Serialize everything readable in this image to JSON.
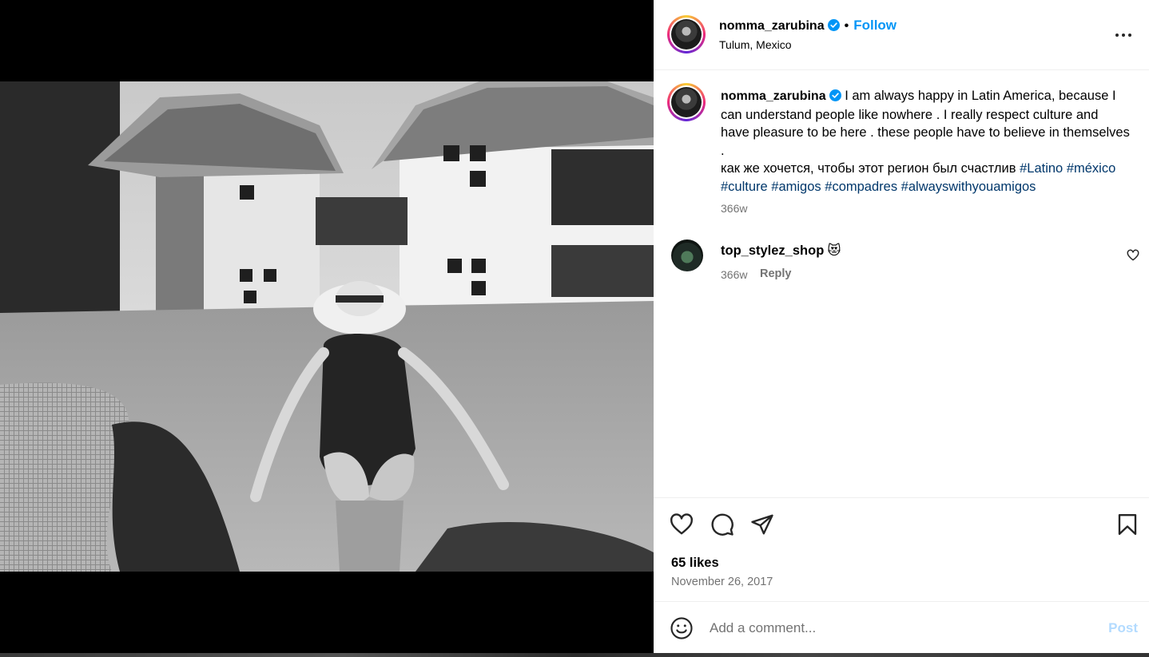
{
  "post": {
    "username": "nomma_zarubina",
    "follow_label": "Follow",
    "location": "Tulum, Mexico",
    "caption": {
      "line1": "I am always happy in Latin America, because I can understand people like nowhere . I really respect culture and have pleasure to be here . these people have to believe in themselves .",
      "line2": "как же хочется, чтобы этот регион был счастлив",
      "tags": [
        "#Latino",
        "#méxico",
        "#culture",
        "#amigos",
        "#compadres",
        "#alwayswithyouamigos"
      ],
      "time": "366w"
    },
    "comments": [
      {
        "username": "top_stylez_shop",
        "text": "😻",
        "time": "366w",
        "reply_label": "Reply"
      }
    ],
    "likes": "65 likes",
    "date": "November 26, 2017",
    "composer": {
      "placeholder": "Add a comment...",
      "post_label": "Post"
    }
  },
  "colors": {
    "link_blue": "#0095f6",
    "hashtag": "#00376b",
    "muted": "#737373",
    "post_disabled": "#b3dbff"
  },
  "icons": [
    "more-options-icon",
    "verified-icon",
    "heart-icon",
    "comment-icon",
    "share-icon",
    "bookmark-icon",
    "emoji-icon"
  ]
}
